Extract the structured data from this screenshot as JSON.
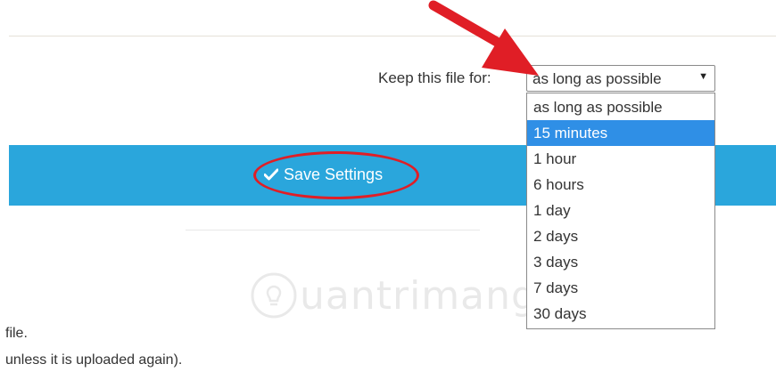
{
  "settings": {
    "keep_label": "Keep this file for:",
    "selected_value": "as long as possible",
    "caret": "▼",
    "options": [
      "as long as possible",
      "15 minutes",
      "1 hour",
      "6 hours",
      "1 day",
      "2 days",
      "3 days",
      "7 days",
      "30 days"
    ],
    "highlighted_option": "15 minutes",
    "save_label": "Save Settings"
  },
  "watermark": {
    "text": "uantrimang"
  },
  "body": {
    "line1": "file.",
    "line2": "unless it is uploaded again)."
  },
  "colors": {
    "band": "#2aa6dc",
    "highlight": "#2f8fe6",
    "annotation": "#e01e26"
  },
  "icons": {
    "save": "check-icon",
    "select": "caret-down-icon",
    "annotation": "red-arrow",
    "watermark": "lightbulb-icon"
  }
}
